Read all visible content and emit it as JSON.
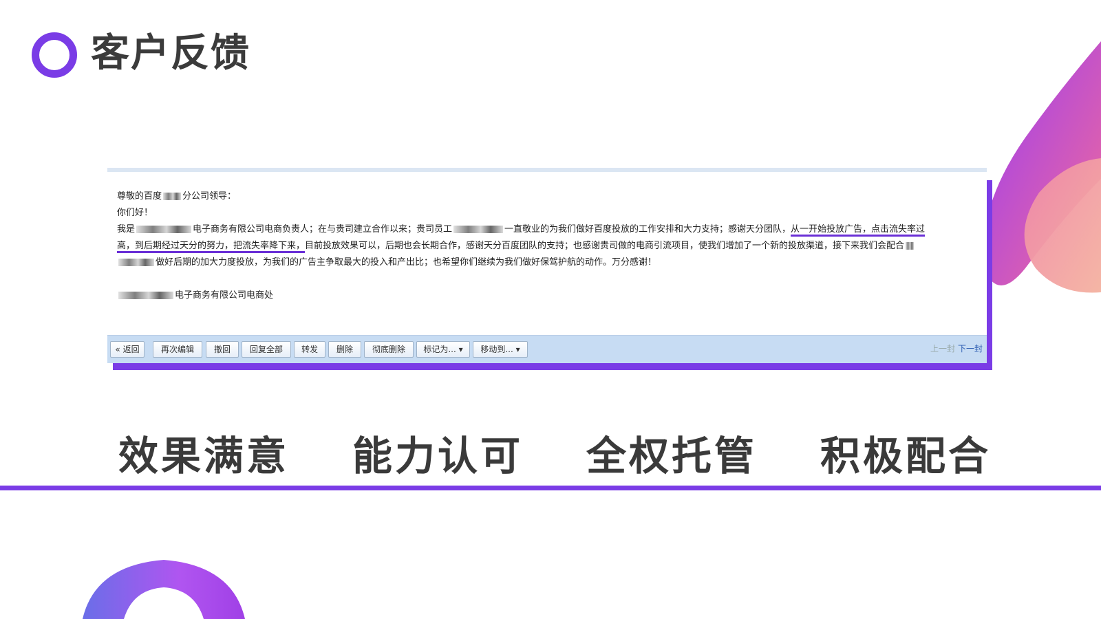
{
  "header": {
    "title": "客户反馈"
  },
  "email": {
    "greeting": "尊敬的百度",
    "greeting_suffix": "分公司领导：",
    "salutation": "你们好！",
    "line1_a": "我是",
    "line1_b": "电子商务有限公司电商负责人；在与贵司建立合作以来；贵司员工",
    "line1_c": "一直敬业的为我们做好百度投放的工作安排和大力支持；感谢天分团队，",
    "line1_hl": "从一开始投放广告，点击流失率过",
    "line2_hl": "高，到后期经过天分的努力，把流失率降下来，",
    "line2_rest": "目前投放效果可以，后期也会长期合作，感谢天分百度团队的支持；也感谢贵司做的电商引流项目，使我们增加了一个新的投放渠道，接下来我们会配合",
    "line3": "做好后期的加大力度投放，为我们的广告主争取最大的投入和产出比；也希望你们继续为我们做好保驾护航的动作。万分感谢！",
    "signature": "电子商务有限公司电商处"
  },
  "toolbar": {
    "back": "« 返回",
    "edit_again": "再次编辑",
    "recall": "撤回",
    "reply_all": "回复全部",
    "forward": "转发",
    "delete": "删除",
    "delete_permanent": "彻底删除",
    "mark_as": "标记为... ▾",
    "move_to": "移动到... ▾",
    "prev": "上一封",
    "next": "下一封"
  },
  "features": [
    "效果满意",
    "能力认可",
    "全权托管",
    "积极配合"
  ],
  "colors": {
    "accent": "#7a3ce6",
    "toolbar": "#c7dcf3",
    "gradient_pink": "#f06a9b",
    "gradient_purple": "#8a3cf0"
  }
}
